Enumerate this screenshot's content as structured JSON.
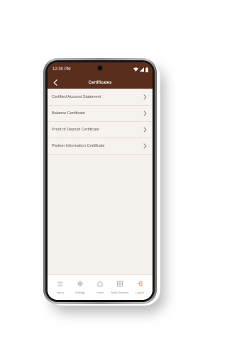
{
  "status_bar": {
    "time": "12:30 PM",
    "icons": [
      "wifi-icon",
      "signal-icon",
      "battery-icon"
    ]
  },
  "header": {
    "title": "Certificates",
    "back_icon": "chevron-left-icon",
    "background_color": "#5a2d1c"
  },
  "certificates": [
    {
      "label": "Certified Account Statement"
    },
    {
      "label": "Balance Certificate"
    },
    {
      "label": "Proof of Deposit Certificate"
    },
    {
      "label": "Partner Information Certificate"
    }
  ],
  "bottom_nav": [
    {
      "label": "Menu",
      "icon": "menu-icon"
    },
    {
      "label": "Settings",
      "icon": "gear-icon"
    },
    {
      "label": "Home",
      "icon": "home-icon"
    },
    {
      "label": "More Services",
      "icon": "grid-icon"
    },
    {
      "label": "Logout",
      "icon": "logout-icon",
      "color": "#e2763c"
    }
  ]
}
